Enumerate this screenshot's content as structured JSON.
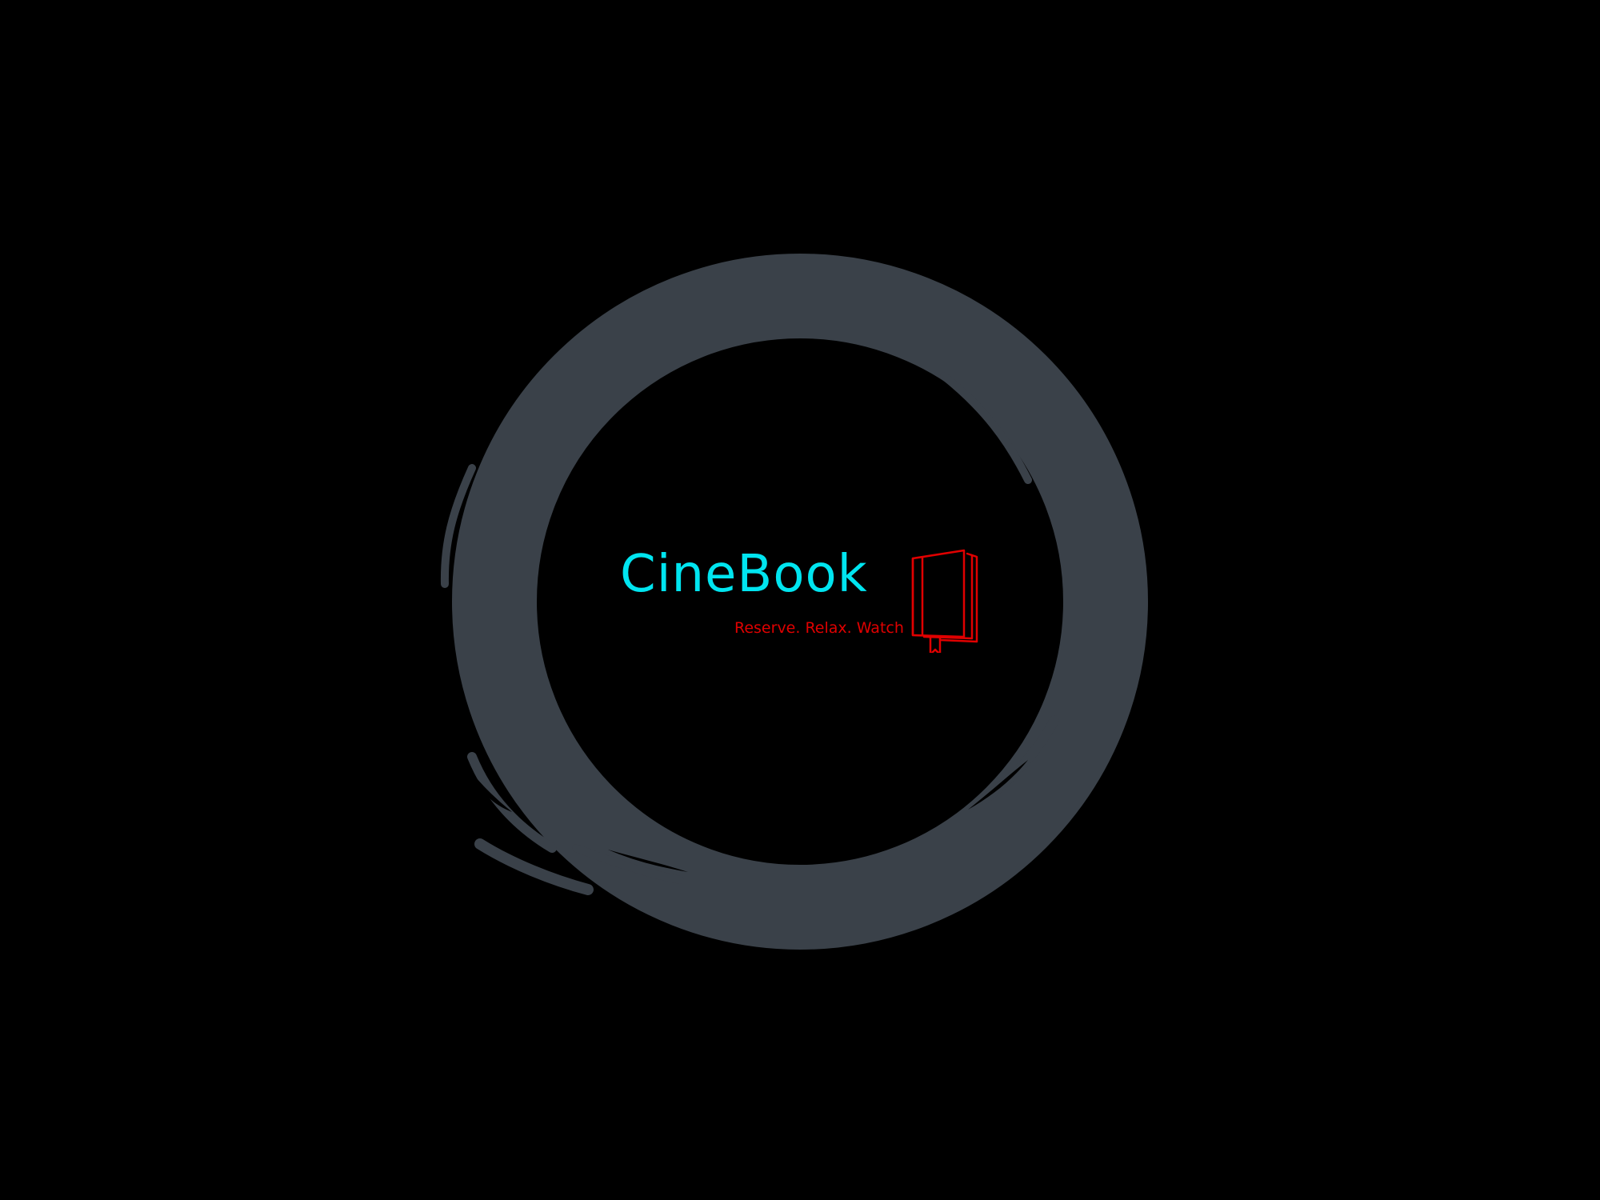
{
  "app": {
    "name": "CineBook",
    "tagline": "Reserve. Relax. Watch"
  },
  "icons": {
    "logo": "book-bookmark-icon",
    "background": "brush-circle-icon"
  },
  "colors": {
    "background": "#000000",
    "ring": "#3a4149",
    "brand": "#00e5f0",
    "accent": "#e00000"
  }
}
